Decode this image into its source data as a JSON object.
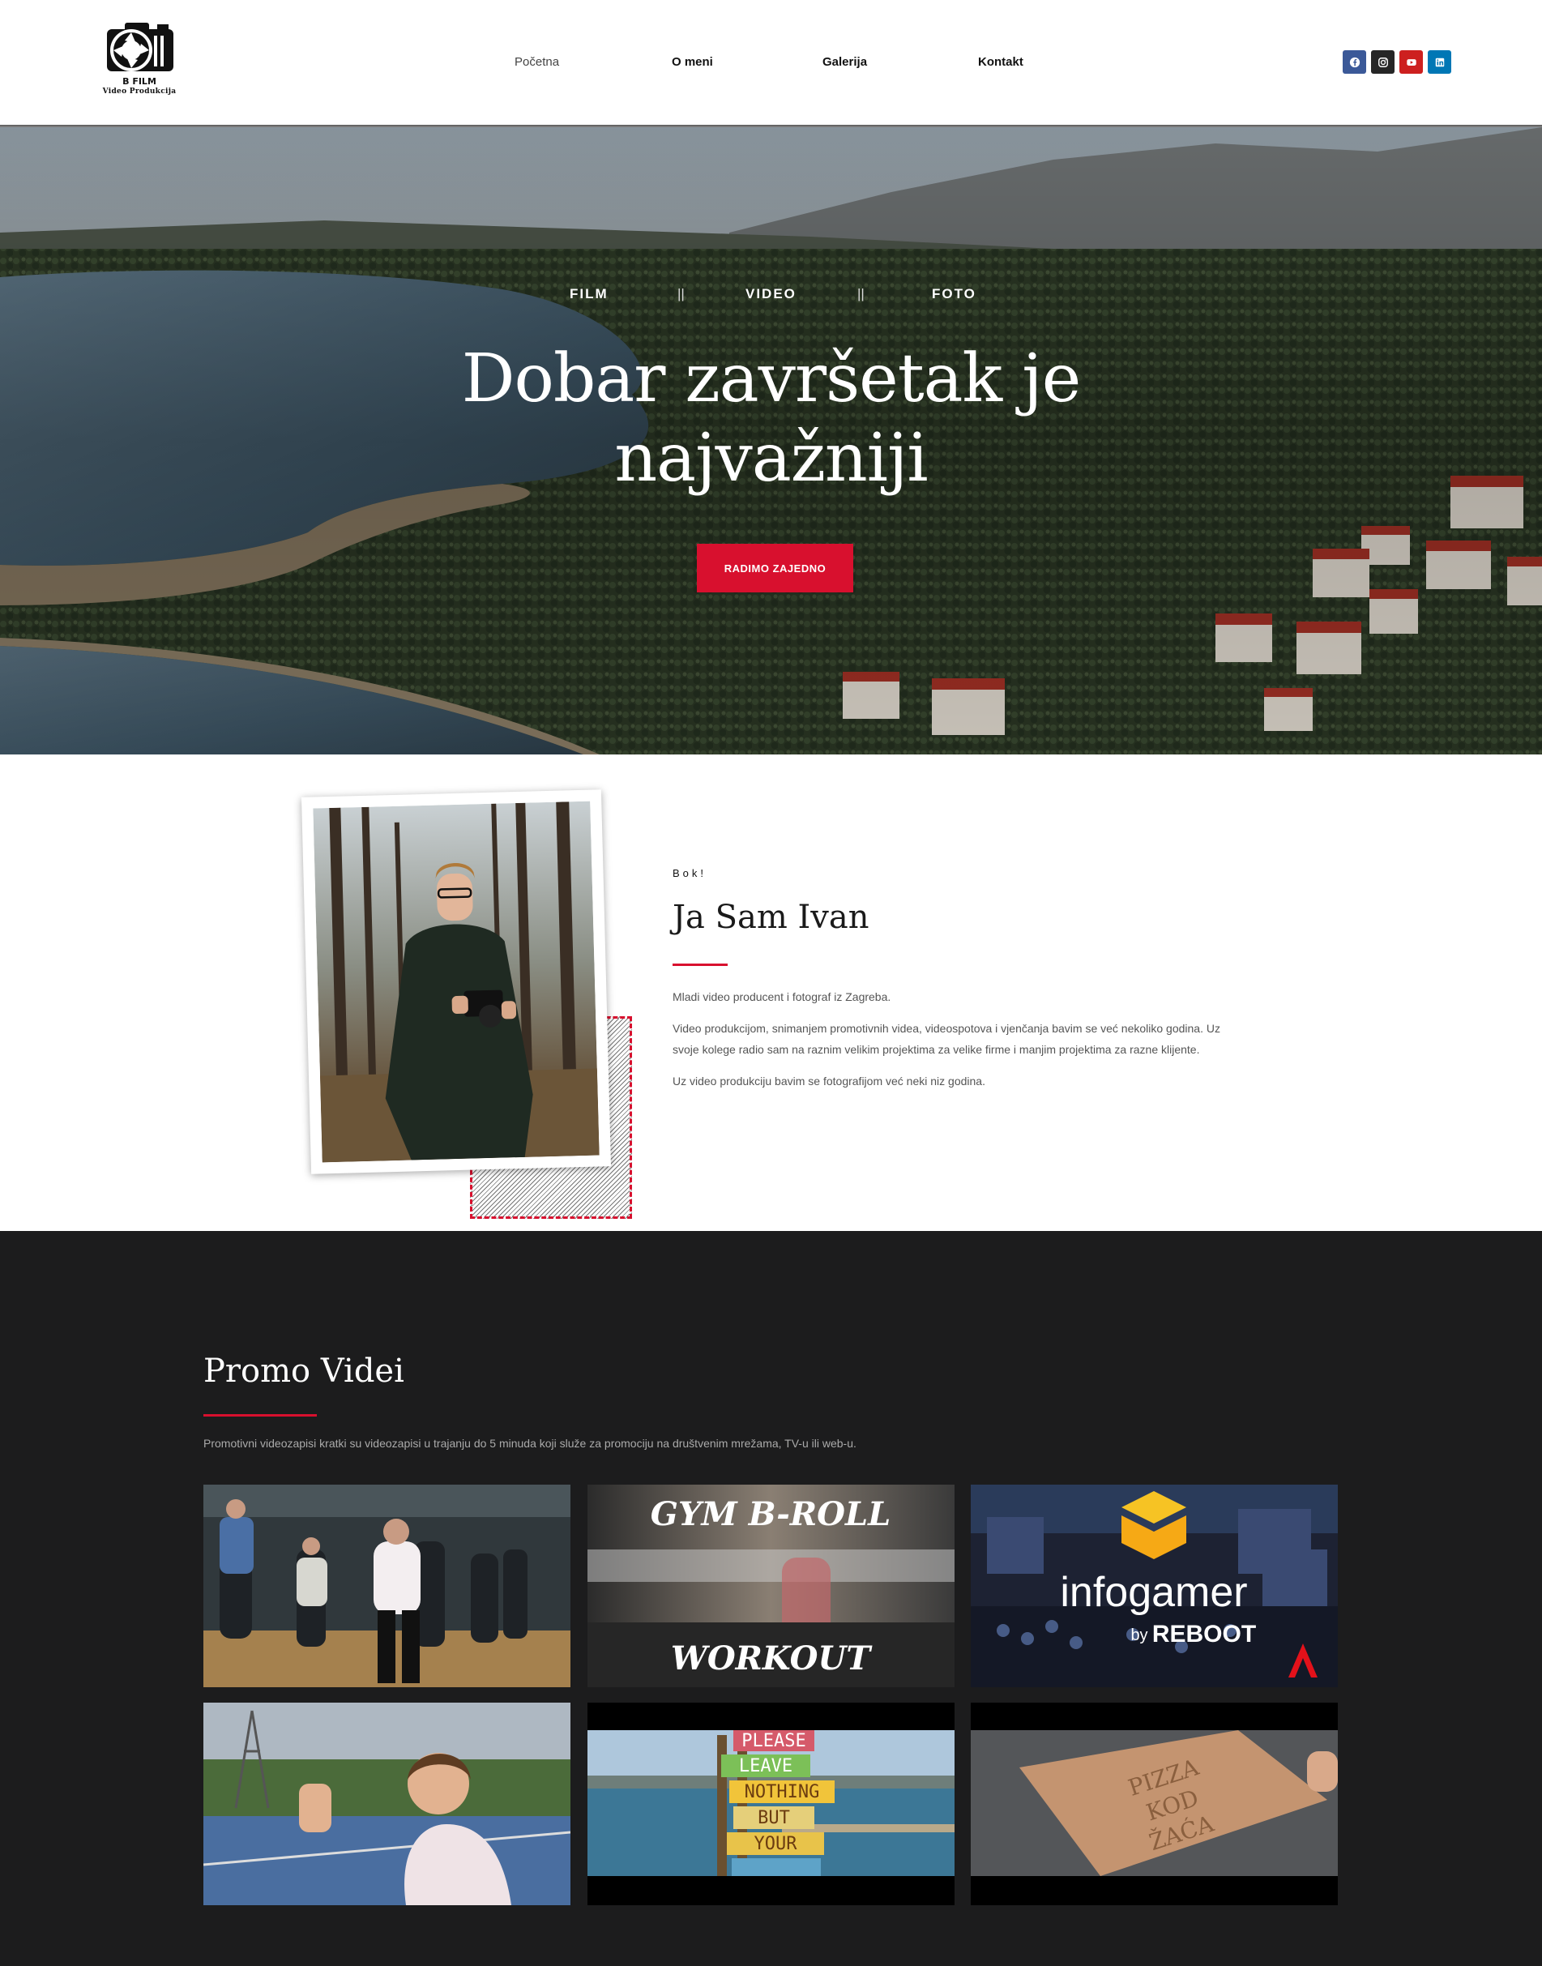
{
  "header": {
    "logo": {
      "line1": "B FILM",
      "line2": "Video Produkcija",
      "icon": "camera-icon"
    },
    "nav": [
      "Početna",
      "O meni",
      "Galerija",
      "Kontakt"
    ],
    "social": [
      {
        "name": "facebook-icon",
        "color": "#3b5998"
      },
      {
        "name": "instagram-icon",
        "color": "#262626"
      },
      {
        "name": "youtube-icon",
        "color": "#cd201f"
      },
      {
        "name": "linkedin-icon",
        "color": "#0077b5"
      }
    ]
  },
  "hero": {
    "tagline": [
      "FILM",
      "VIDEO",
      "FOTO"
    ],
    "separator": "||",
    "title_line1": "Dobar završetak je",
    "title_line2": "najvažniji",
    "cta": "RADIMO ZAJEDNO"
  },
  "about": {
    "hello": "Bok!",
    "title": "Ja Sam Ivan",
    "paragraphs": [
      "Mladi video producent i fotograf iz Zagreba.",
      "Video produkcijom, snimanjem promotivnih videa, videospotova i vjenčanja bavim se već nekoliko godina. Uz svoje kolege radio sam na raznim velikim projektima za velike firme i manjim projektima za razne klijente.",
      "Uz video produkciju bavim se fotografijom već neki niz godina."
    ]
  },
  "promo": {
    "title": "Promo Videi",
    "description": "Promotivni videozapisi kratki su videozapisi u trajanju do 5 minuda koji služe za promociju na društvenim mrežama, TV-u ili web-u.",
    "videos": [
      {
        "name": "dance-video"
      },
      {
        "name": "gym-video",
        "line1": "GYM B-ROLL",
        "line2": "WORKOUT"
      },
      {
        "name": "infogamer-video",
        "brand": "infogamer",
        "by": "by",
        "sponsor": "REBOOT"
      },
      {
        "name": "selfie-video"
      },
      {
        "name": "beach-sign-video",
        "signs": [
          "PLEASE",
          "LEAVE",
          "NOTHING",
          "BUT",
          "YOUR"
        ]
      },
      {
        "name": "pizza-video",
        "box_text": [
          "PIZZA",
          "KOD",
          "ŽAĆA"
        ]
      }
    ]
  },
  "colors": {
    "accent": "#d8102e",
    "dark": "#1c1c1d"
  }
}
